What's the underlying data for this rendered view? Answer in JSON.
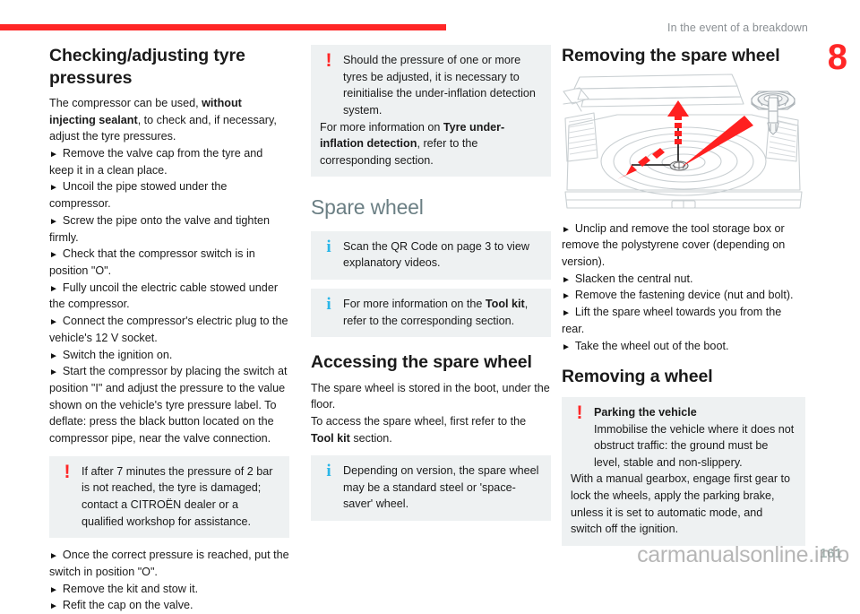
{
  "header": {
    "section_title": "In the event of a breakdown",
    "chapter_number": "8",
    "rule_color": "#FF2626"
  },
  "column1": {
    "heading": "Checking/adjusting tyre pressures",
    "intro_part1": "The compressor can be used, ",
    "intro_bold1": "without injecting sealant",
    "intro_part2": ", to check and, if necessary, adjust the tyre pressures.",
    "steps": [
      "Remove the valve cap from the tyre and keep it in a clean place.",
      "Uncoil the pipe stowed under the compressor.",
      "Screw the pipe onto the valve and tighten firmly.",
      "Check that the compressor switch is in position \"O\".",
      "Fully uncoil the electric cable stowed under the compressor.",
      "Connect the compressor's electric plug to the vehicle's 12 V socket.",
      "Switch the ignition on.",
      "Start the compressor by placing the switch at position \"I\" and adjust the pressure to the value shown on the vehicle's tyre pressure label. To deflate: press the black button located on the compressor pipe, near the valve connection."
    ],
    "warning": {
      "icon": "warning-exclamation-icon",
      "text": "If after 7 minutes the pressure of 2 bar is not reached, the tyre is damaged; contact a CITROËN dealer or a qualified workshop for assistance."
    },
    "steps_after": [
      "Once the correct pressure is reached, put the switch in position \"O\".",
      "Remove the kit and stow it.",
      "Refit the cap on the valve."
    ]
  },
  "column2": {
    "warning": {
      "icon": "warning-exclamation-icon",
      "text_part1": "Should the pressure of one or more tyres be adjusted, it is necessary to reinitialise the under-inflation detection system.",
      "text_part2_pre": "For more information on ",
      "text_part2_bold": "Tyre under-inflation detection",
      "text_part2_post": ", refer to the corresponding section."
    },
    "grey_heading": "Spare wheel",
    "info1": {
      "icon": "info-i-icon",
      "text": "Scan the QR Code on page 3 to view explanatory videos."
    },
    "info2": {
      "icon": "info-i-icon",
      "text_pre": "For more information on the ",
      "text_bold": "Tool kit",
      "text_post": ", refer to the corresponding section."
    },
    "heading": "Accessing the spare wheel",
    "body1": "The spare wheel is stored in the boot, under the floor.",
    "body2_pre": "To access the spare wheel, first refer to the ",
    "body2_bold": "Tool kit",
    "body2_post": " section.",
    "info3": {
      "icon": "info-i-icon",
      "text": "Depending on version, the spare wheel may be a standard steel or 'space-saver' wheel."
    }
  },
  "column3": {
    "heading": "Removing the spare wheel",
    "figure": {
      "name": "boot-spare-wheel-illustration",
      "caption": "",
      "accent_color": "#FF2020"
    },
    "steps": [
      "Unclip and remove the tool storage box or remove the polystyrene cover (depending on version).",
      "Slacken the central nut.",
      "Remove the fastening device (nut and bolt).",
      "Lift the spare wheel towards you from the rear.",
      "Take the wheel out of the boot."
    ],
    "heading2": "Removing a wheel",
    "warning": {
      "icon": "warning-exclamation-icon",
      "title": "Parking the vehicle",
      "text_line1": "Immobilise the vehicle where it does not obstruct traffic: the ground must be level, stable and non-slippery.",
      "text_line2": "With a manual gearbox, engage first gear to lock the wheels, apply the parking brake, unless it is set to automatic mode, and switch off the ignition."
    }
  },
  "footer": {
    "watermark": "carmanualsonline.info",
    "page_number": "161"
  }
}
